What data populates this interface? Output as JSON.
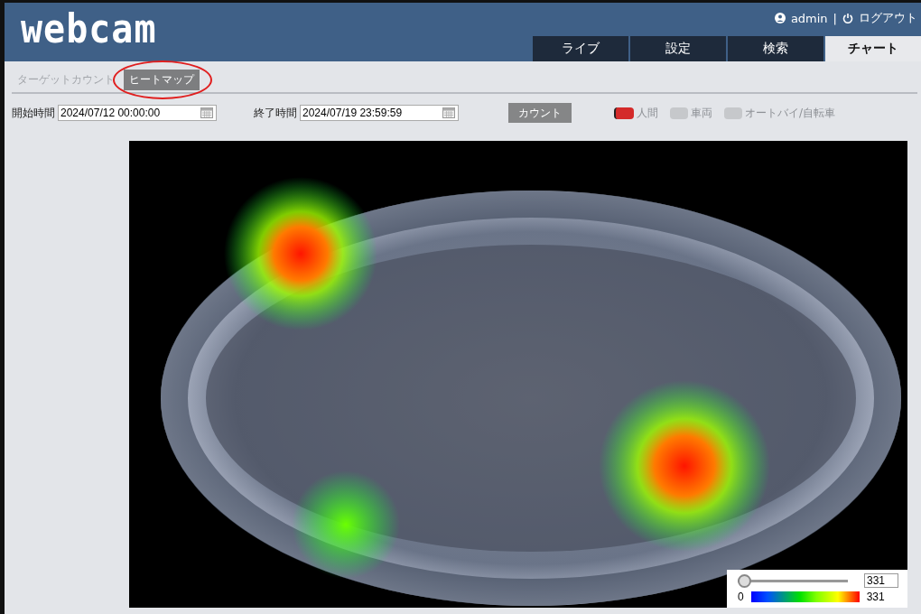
{
  "header": {
    "logo": "webcam",
    "user": "admin",
    "separator": "|",
    "logout": "ログアウト"
  },
  "main_tabs": [
    {
      "label": "ライブ",
      "selected": false
    },
    {
      "label": "設定",
      "selected": false
    },
    {
      "label": "検索",
      "selected": false
    },
    {
      "label": "チャート",
      "selected": true
    }
  ],
  "sub_tabs": [
    {
      "label": "ターゲットカウント",
      "selected": false,
      "highlighted": false
    },
    {
      "label": "ヒートマップ",
      "selected": true,
      "highlighted": true
    }
  ],
  "filters": {
    "start_label": "開始時間",
    "start_value": "2024/07/12 00:00:00",
    "end_label": "終了時間",
    "end_value": "2024/07/19 23:59:59",
    "count_button": "カウント",
    "targets": [
      {
        "label": "人間",
        "checked": true
      },
      {
        "label": "車両",
        "checked": false
      },
      {
        "label": "オートバイ/自転車",
        "checked": false
      }
    ]
  },
  "legend": {
    "slider": {
      "level": 0
    },
    "threshold": "331",
    "scale_min": "0",
    "scale_max": "331"
  }
}
